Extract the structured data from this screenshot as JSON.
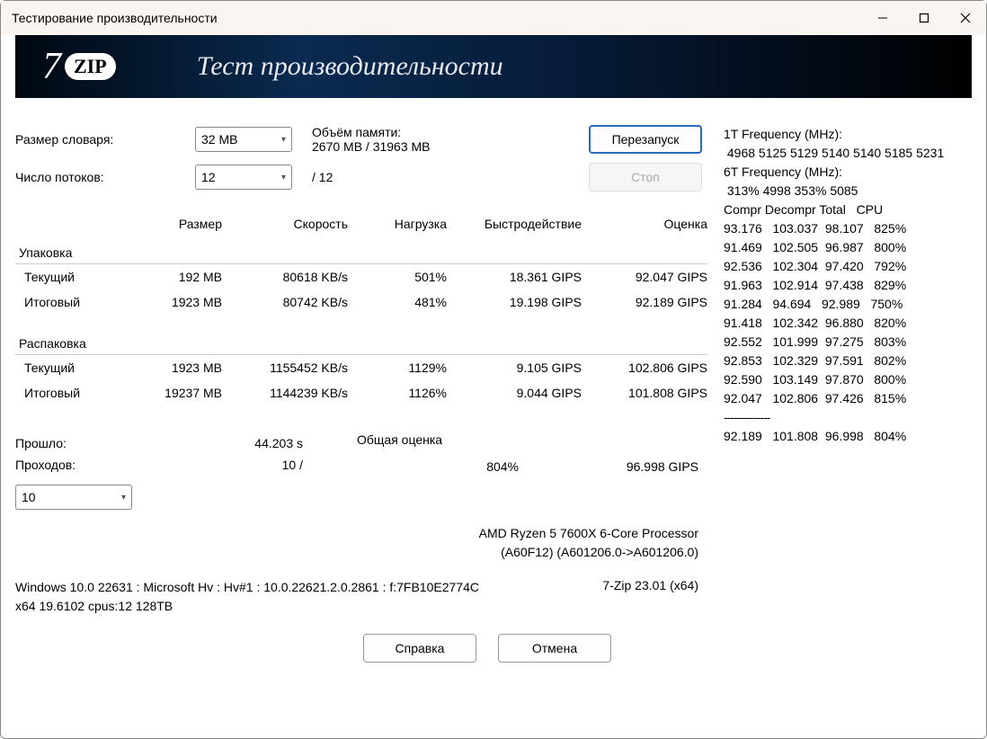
{
  "window": {
    "title": "Тестирование производительности"
  },
  "banner": {
    "text": "Тест производительности"
  },
  "controls": {
    "dict_label": "Размер словаря:",
    "dict_value": "32 MB",
    "mem_label": "Объём памяти:",
    "mem_value": "2670 MB / 31963 MB",
    "threads_label": "Число потоков:",
    "threads_value": "12",
    "threads_max": "/ 12",
    "restart": "Перезапуск",
    "stop": "Стоп"
  },
  "table": {
    "headers": {
      "size": "Размер",
      "speed": "Скорость",
      "load": "Нагрузка",
      "perf": "Быстродействие",
      "rating": "Оценка"
    },
    "pack_label": "Упаковка",
    "unpack_label": "Распаковка",
    "current_label": "Текущий",
    "total_label": "Итоговый",
    "pack_current": {
      "size": "192 MB",
      "speed": "80618 KB/s",
      "load": "501%",
      "perf": "18.361 GIPS",
      "rating": "92.047 GIPS"
    },
    "pack_total": {
      "size": "1923 MB",
      "speed": "80742 KB/s",
      "load": "481%",
      "perf": "19.198 GIPS",
      "rating": "92.189 GIPS"
    },
    "unpack_current": {
      "size": "1923 MB",
      "speed": "1155452 KB/s",
      "load": "1129%",
      "perf": "9.105 GIPS",
      "rating": "102.806 GIPS"
    },
    "unpack_total": {
      "size": "19237 MB",
      "speed": "1144239 KB/s",
      "load": "1126%",
      "perf": "9.044 GIPS",
      "rating": "101.808 GIPS"
    }
  },
  "summary": {
    "elapsed_label": "Прошло:",
    "elapsed_value": "44.203 s",
    "passes_label": "Проходов:",
    "passes_value": "10 /",
    "passes_combo": "10",
    "overall_label": "Общая оценка",
    "overall_load": "804%",
    "overall_rating": "96.998 GIPS"
  },
  "cpu": {
    "name": "AMD Ryzen 5 7600X 6-Core Processor",
    "id": "(A60F12) (A601206.0->A601206.0)"
  },
  "footer": {
    "os": "Windows 10.0 22631 : Microsoft Hv : Hv#1 : 10.0.22621.2.0.2861 : f:7FB10E2774C",
    "arch": "x64 19.6102 cpus:12 128TB",
    "version": "7-Zip 23.01 (x64)"
  },
  "buttons": {
    "help": "Справка",
    "cancel": "Отмена"
  },
  "side": {
    "freq1_label": "1T Frequency (MHz):",
    "freq1_values": " 4968 5125 5129 5140 5140 5185 5231",
    "freq6_label": "6T Frequency (MHz):",
    "freq6_values": " 313% 4998 353% 5085",
    "cols": "Compr Decompr Total   CPU",
    "rows": [
      "93.176   103.037  98.107   825%",
      "91.469   102.505  96.987   800%",
      "92.536   102.304  97.420   792%",
      "91.963   102.914  97.438   829%",
      "91.284   94.694   92.989   750%",
      "91.418   102.342  96.880   820%",
      "92.552   101.999  97.275   803%",
      "92.853   102.329  97.591   802%",
      "92.590   103.149  97.870   800%",
      "92.047   102.806  97.426   815%"
    ],
    "divider": "--------------",
    "total": "92.189   101.808  96.998   804%"
  }
}
